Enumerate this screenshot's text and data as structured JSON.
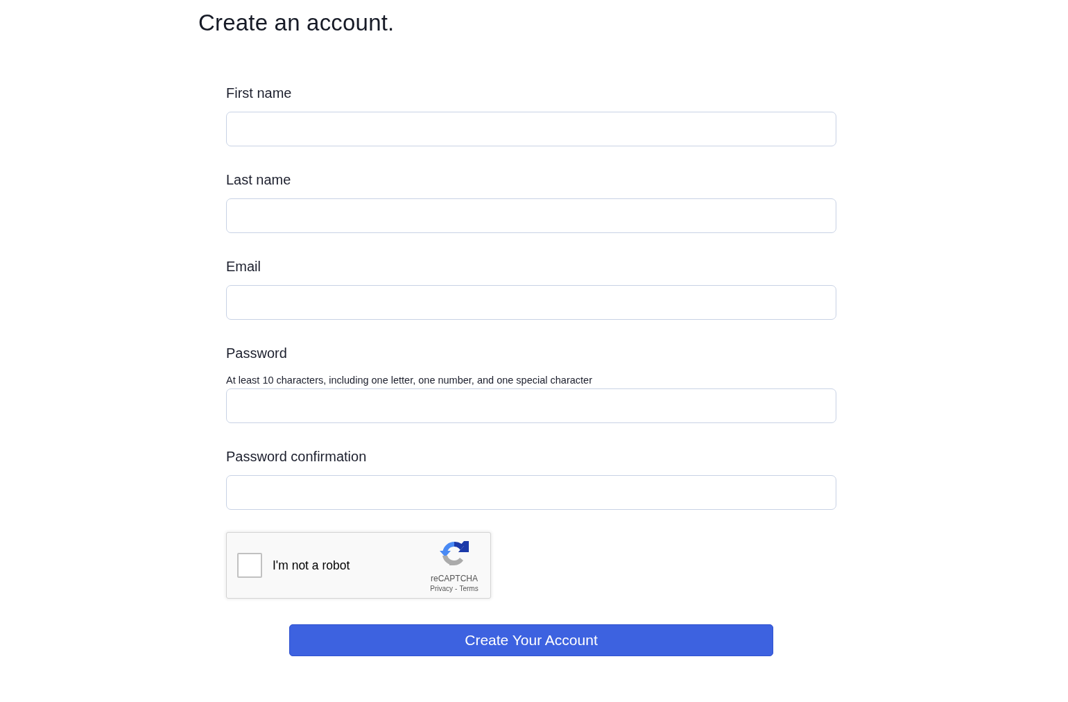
{
  "title": "Create an account.",
  "fields": [
    {
      "label": "First name"
    },
    {
      "label": "Last name"
    },
    {
      "label": "Email"
    },
    {
      "label": "Password",
      "hint": "At least 10 characters, including one letter, one number, and one special character"
    },
    {
      "label": "Password confirmation"
    }
  ],
  "captcha": {
    "label": "I'm not a robot",
    "checked": false,
    "brand": "reCAPTCHA",
    "links": [
      "Privacy",
      "Terms"
    ],
    "separator": "-"
  },
  "submit": {
    "label": "Create Your Account"
  }
}
